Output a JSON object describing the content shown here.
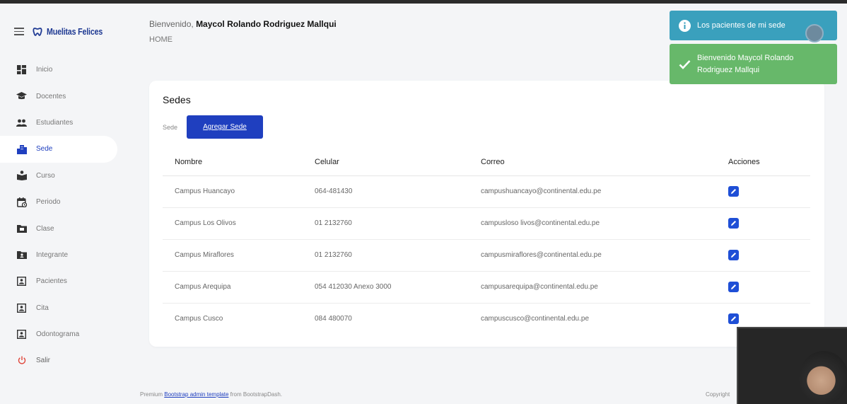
{
  "brand": {
    "name": "Muelitas Felices"
  },
  "header": {
    "greeting": "Bienvenido,",
    "user_name": "Maycol Rolando Rodriguez Mallqui",
    "breadcrumb": "HOME"
  },
  "sidebar": {
    "items": [
      {
        "label": "Inicio",
        "icon": "dashboard-icon"
      },
      {
        "label": "Docentes",
        "icon": "graduation-cap-icon"
      },
      {
        "label": "Estudiantes",
        "icon": "users-icon"
      },
      {
        "label": "Sede",
        "icon": "building-icon"
      },
      {
        "label": "Curso",
        "icon": "book-icon"
      },
      {
        "label": "Periodo",
        "icon": "calendar-icon"
      },
      {
        "label": "Clase",
        "icon": "folder-icon"
      },
      {
        "label": "Integrante",
        "icon": "folder-user-icon"
      },
      {
        "label": "Pacientes",
        "icon": "person-card-icon"
      },
      {
        "label": "Cita",
        "icon": "person-card-icon"
      },
      {
        "label": "Odontograma",
        "icon": "person-card-icon"
      }
    ],
    "logout_label": "Salir",
    "active": "Sede"
  },
  "card": {
    "title": "Sedes",
    "filter_label": "Sede",
    "add_button": "Agregar Sede",
    "columns": [
      "Nombre",
      "Celular",
      "Correo",
      "Acciones"
    ],
    "rows": [
      {
        "nombre": "Campus Huancayo",
        "celular": "064-481430",
        "correo": "campushuancayo@continental.edu.pe"
      },
      {
        "nombre": "Campus Los Olivos",
        "celular": "01 2132760",
        "correo": "campusloso livos@continental.edu.pe"
      },
      {
        "nombre": "Campus Miraflores",
        "celular": "01 2132760",
        "correo": "campusmiraflores@continental.edu.pe"
      },
      {
        "nombre": "Campus Arequipa",
        "celular": "054 412030 Anexo 3000",
        "correo": "campusarequipa@continental.edu.pe"
      },
      {
        "nombre": "Campus Cusco",
        "celular": "084 480070",
        "correo": "campuscusco@continental.edu.pe"
      }
    ]
  },
  "footer": {
    "prefix": "Premium",
    "link": "Bootstrap admin template",
    "suffix": "from BootstrapDash.",
    "right": "Copyright"
  },
  "toasts": {
    "info": "Los pacientes de mi sede",
    "success": "Bienvenido Maycol Rolando Rodriguez Mallqui"
  },
  "colors": {
    "accent": "#1f3fbf",
    "toast_info": "#3aa0bd",
    "toast_success": "#67b86a"
  }
}
